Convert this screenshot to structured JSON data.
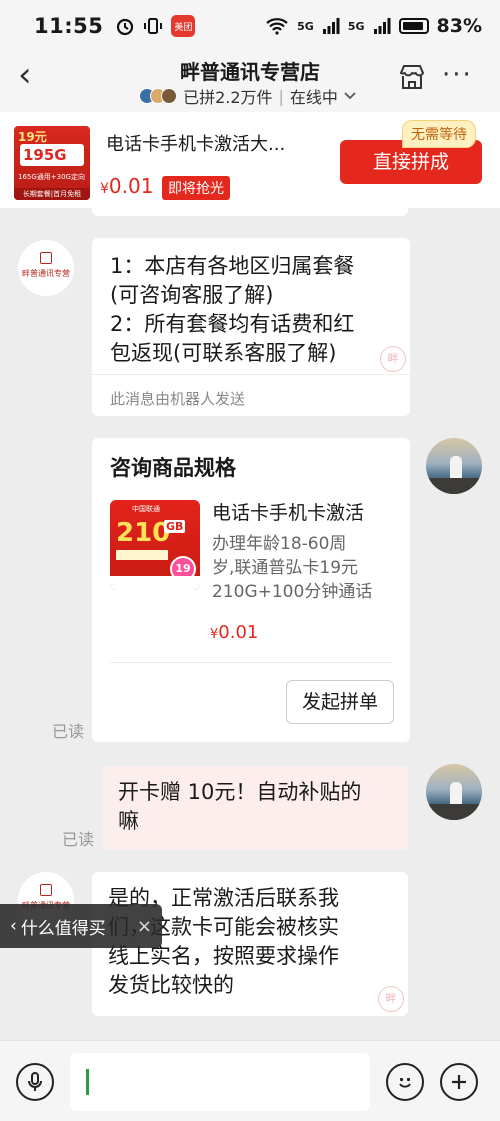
{
  "status_bar": {
    "time": "11:55",
    "net1": "5G",
    "net2": "5G",
    "battery_pct": "83%",
    "app_icon_label": "美团"
  },
  "header": {
    "shop_name": "畔普通讯专营店",
    "group_info": "已拼2.2万件",
    "online_status": "在线中"
  },
  "product_bar": {
    "thumb_price_label": "19元",
    "thumb_data_label": "195G",
    "thumb_data_detail": "165G通用+30G定向",
    "thumb_footer": "长期套餐|首月免租",
    "name": "电话卡手机卡激活大...",
    "price_symbol": "¥",
    "price_value": "0.01",
    "promo_badge": "即将抢光",
    "no_wait_tag": "无需等待",
    "buy_button": "直接拼成"
  },
  "shop_avatar": {
    "seal_text": "畔普通讯专营"
  },
  "messages": {
    "bot_message": {
      "text": "1：本店有各地区归属套餐(可咨询客服了解)\n2：所有套餐均有话费和红包返现(可联系客服了解)",
      "line1": "1：本店有各地区归属套餐",
      "line2": "(可咨询客服了解)",
      "line3": "2：所有套餐均有话费和红",
      "line4": "包返现(可联系客服了解)",
      "note": "此消息由机器人发送",
      "watermark": "畔"
    },
    "product_card": {
      "title": "咨询商品规格",
      "img_gb": "210",
      "img_gb_unit": "GB",
      "img_logo": "中国联通",
      "img_badge": "19",
      "name": "电话卡手机卡激活",
      "desc_line1": "办理年龄18-60周",
      "desc_line2": "岁,联通普弘卡19元",
      "desc_line3": "210G+100分钟通话",
      "price_symbol": "¥",
      "price_value": "0.01",
      "action_button": "发起拼单",
      "read_label": "已读"
    },
    "user_message": {
      "line1": "开卡赠 10元！自动补贴的",
      "line2": "嘛",
      "read_label": "已读"
    },
    "shop_reply": {
      "line1": "是的，正常激活后联系我",
      "line2": "们，这款卡可能会被核实",
      "line3": "线上实名，按照要求操作",
      "line4": "发货比较快的",
      "watermark": "畔"
    }
  },
  "floating_pill": {
    "label": "什么值得买",
    "back_icon": "‹",
    "close_icon": "×"
  },
  "input_bar": {
    "placeholder": ""
  },
  "colors": {
    "accent_red": "#e4281e",
    "chat_bg": "#ededed",
    "user_bubble": "#fdeeee"
  }
}
